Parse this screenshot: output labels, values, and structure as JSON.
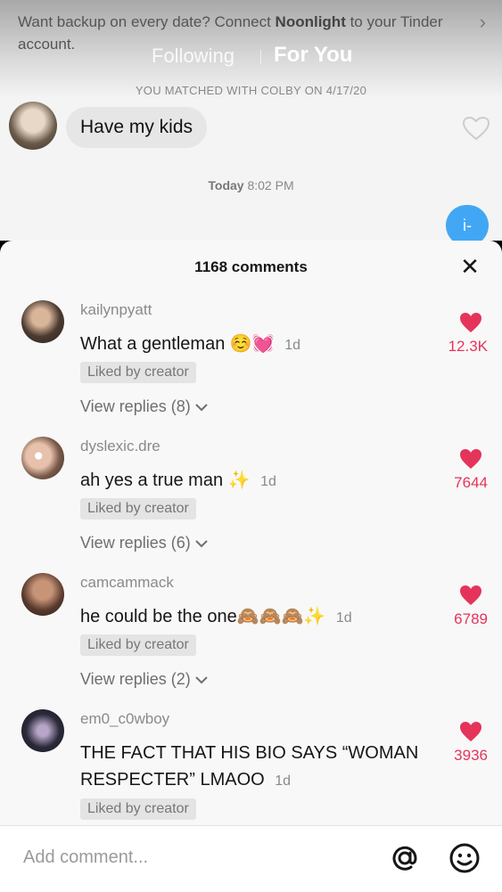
{
  "background": {
    "banner_text": "Want backup on every date? Connect ",
    "banner_brand": "Noonlight",
    "banner_text_end": " to your Tinder account.",
    "tabs": {
      "following": "Following",
      "for_you": "For You"
    },
    "matched_text": "YOU MATCHED WITH COLBY ON 4/17/20",
    "message": "Have my kids",
    "today_label": "Today",
    "today_time": "8:02 PM",
    "reply_bubble": "i-"
  },
  "comments_sheet": {
    "title": "1168 comments",
    "comments": [
      {
        "user": "kailynpyatt",
        "text": "What a gentleman",
        "emojis": [
          "☺️",
          "💓"
        ],
        "time": "1d",
        "badge": "Liked by creator",
        "replies": "View replies (8)",
        "likes": "12.3K"
      },
      {
        "user": "dyslexic.dre",
        "text": "ah yes a true man",
        "emojis": [
          "✨"
        ],
        "time": "1d",
        "badge": "Liked by creator",
        "replies": "View replies (6)",
        "likes": "7644"
      },
      {
        "user": "camcammack",
        "text": "he could be the one",
        "emojis": [
          "🙈",
          "🙈",
          "🙈",
          "✨"
        ],
        "time": "1d",
        "badge": "Liked by creator",
        "replies": "View replies (2)",
        "likes": "6789"
      },
      {
        "user": "em0_c0wboy",
        "text": "THE FACT THAT HIS BIO SAYS “WOMAN RESPECTER” LMAOO",
        "emojis": [],
        "time": "1d",
        "badge": "Liked by creator",
        "replies": "",
        "likes": "3936"
      }
    ]
  },
  "input": {
    "placeholder": "Add comment..."
  },
  "icons": {
    "close": "close-icon",
    "heart": "heart-icon",
    "at": "at-mention-icon",
    "emoji": "emoji-icon",
    "chevron": "chevron-down-icon"
  },
  "colors": {
    "heart": "#e5345a",
    "blue_bubble": "#41a7f5"
  }
}
